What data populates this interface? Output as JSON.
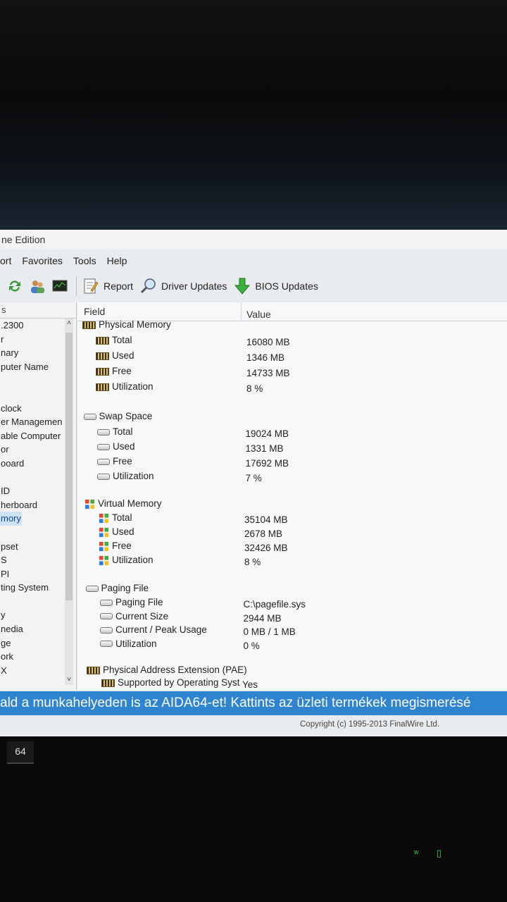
{
  "window": {
    "title": "ne Edition"
  },
  "menu": [
    "ort",
    "Favorites",
    "Tools",
    "Help"
  ],
  "toolbar": {
    "report_label": "Report",
    "driver_updates_label": "Driver Updates",
    "bios_updates_label": "BIOS Updates"
  },
  "left_panel": {
    "header": "s",
    "items": [
      ".2300",
      "r",
      "nary",
      "puter Name",
      "",
      "",
      "clock",
      "er Managemen",
      "able Computer",
      "or",
      "ooard",
      "",
      "ID",
      "herboard",
      "mory",
      "",
      "pset",
      "S",
      "PI",
      "ting System",
      "",
      "y",
      "nedia",
      "ge",
      "ork",
      "X"
    ],
    "selected_index": 14
  },
  "columns": {
    "field": "Field",
    "value": "Value"
  },
  "sections": [
    {
      "name": "Physical Memory",
      "icon": "ram-icon",
      "rows": [
        {
          "field": "Total",
          "value": "16080 MB"
        },
        {
          "field": "Used",
          "value": "1346 MB"
        },
        {
          "field": "Free",
          "value": "14733 MB"
        },
        {
          "field": "Utilization",
          "value": "8 %"
        }
      ]
    },
    {
      "name": "Swap Space",
      "icon": "disk-icon",
      "rows": [
        {
          "field": "Total",
          "value": "19024 MB"
        },
        {
          "field": "Used",
          "value": "1331 MB"
        },
        {
          "field": "Free",
          "value": "17692 MB"
        },
        {
          "field": "Utilization",
          "value": "7 %"
        }
      ]
    },
    {
      "name": "Virtual Memory",
      "icon": "windows-icon",
      "rows": [
        {
          "field": "Total",
          "value": "35104 MB"
        },
        {
          "field": "Used",
          "value": "2678 MB"
        },
        {
          "field": "Free",
          "value": "32426 MB"
        },
        {
          "field": "Utilization",
          "value": "8 %"
        }
      ]
    },
    {
      "name": "Paging File",
      "icon": "disk-icon",
      "rows": [
        {
          "field": "Paging File",
          "value": "C:\\pagefile.sys"
        },
        {
          "field": "Current Size",
          "value": "2944 MB"
        },
        {
          "field": "Current / Peak Usage",
          "value": "0 MB / 1 MB"
        },
        {
          "field": "Utilization",
          "value": "0 %"
        }
      ]
    },
    {
      "name": "Physical Address Extension (PAE)",
      "icon": "ram-icon",
      "rows": [
        {
          "field": "Supported by Operating Syst",
          "value": "Yes"
        }
      ]
    }
  ],
  "banner": {
    "text": "ald a munkahelyeden is az AIDA64-et! Kattints az üzleti termékek megismerésé"
  },
  "status": {
    "copyright": "Copyright (c) 1995-2013 FinalWire Ltd."
  },
  "taskbar": {
    "app_label": "64"
  },
  "colors": {
    "banner": "#2f84cf",
    "selection": "#cfe3f7",
    "tray": "#3bdc46"
  }
}
